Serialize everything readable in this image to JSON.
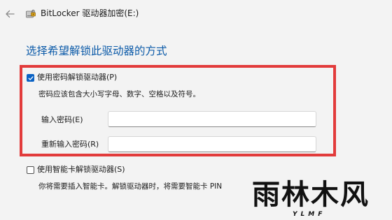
{
  "window": {
    "title": "BitLocker 驱动器加密(E:)"
  },
  "heading": "选择希望解锁此驱动器的方式",
  "options": {
    "password": {
      "label": "使用密码解锁驱动器(P)",
      "checked": true,
      "description": "密码应该包含大小写字母、数字、空格以及符号。",
      "fields": {
        "enter_label": "输入密码(E)",
        "enter_value": "",
        "reenter_label": "重新输入密码(R)",
        "reenter_value": ""
      }
    },
    "smartcard": {
      "label": "使用智能卡解锁驱动器(S)",
      "checked": false,
      "description": "你将需要插入智能卡。解锁驱动器时，将需要智能卡 PIN"
    }
  },
  "watermark": {
    "text": "雨林木风",
    "subtext": "YLMF"
  },
  "colors": {
    "accent": "#0a62c4",
    "heading": "#0b5aa8",
    "highlight_frame": "#e23b3b",
    "background": "#f3f3f3"
  }
}
